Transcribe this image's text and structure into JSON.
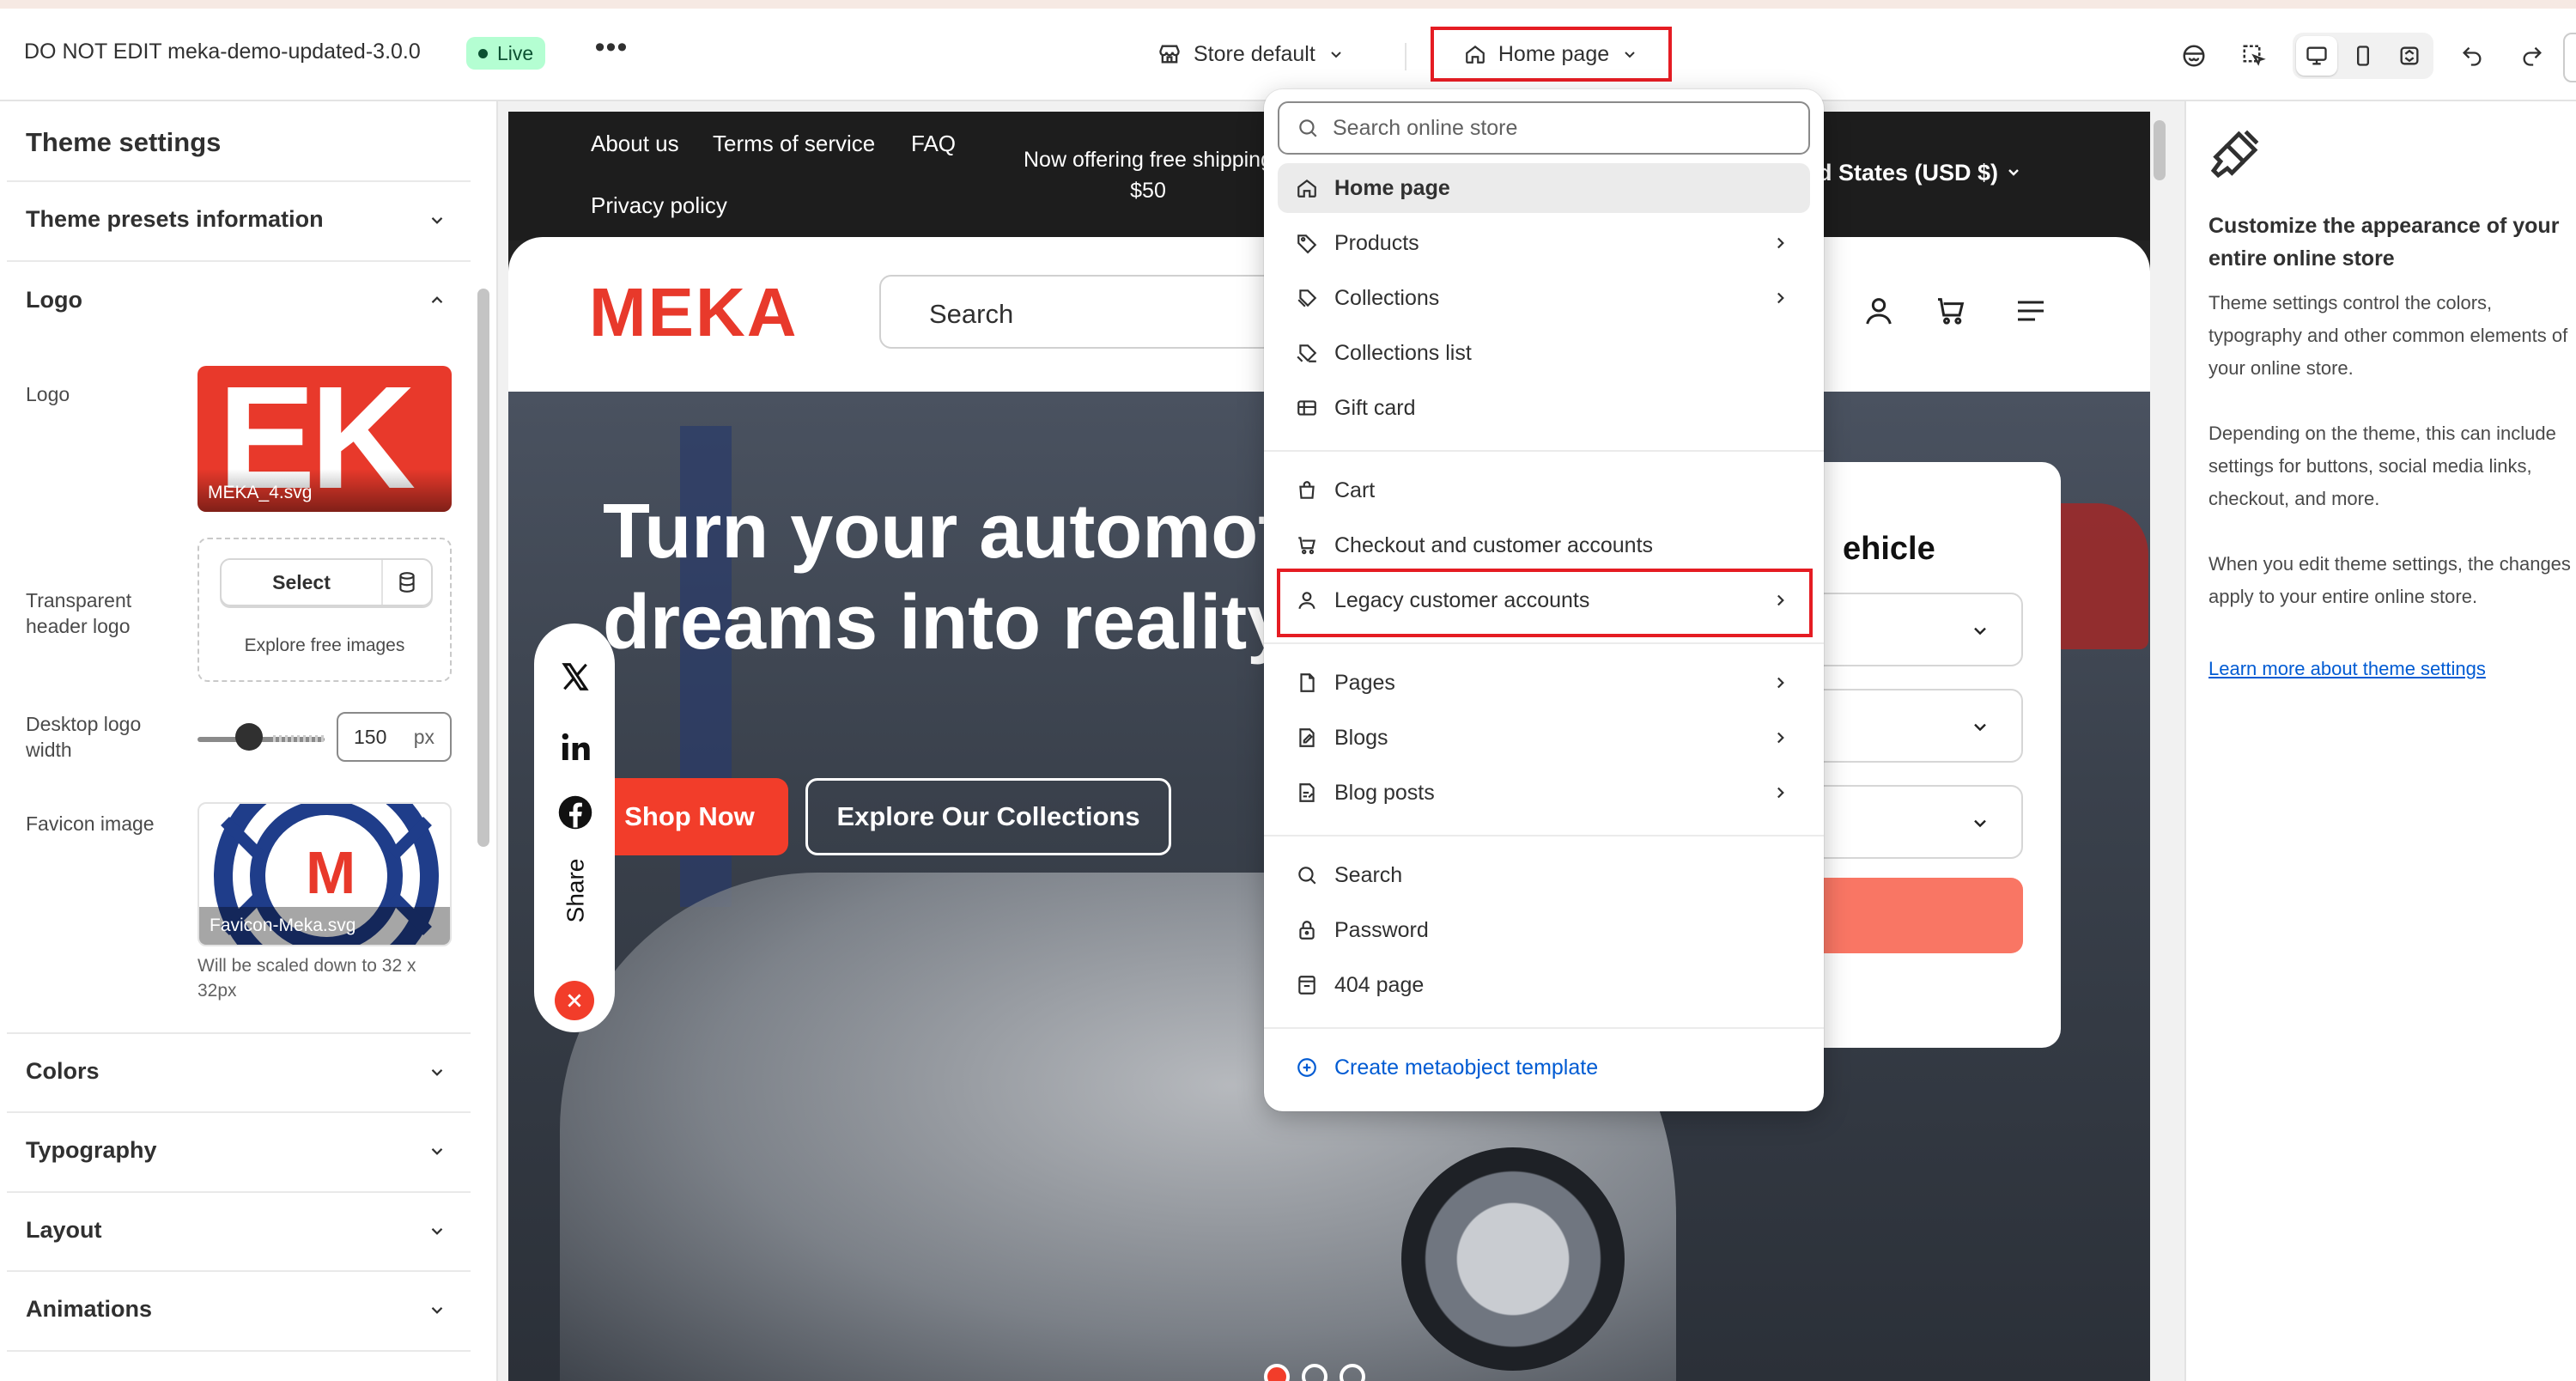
{
  "topbar": {
    "theme_name": "DO NOT EDIT meka-demo-updated-3.0.0",
    "live_badge": "Live",
    "more_label": "•••",
    "store_select": "Store default",
    "template_select": "Home page"
  },
  "left_panel": {
    "title": "Theme settings",
    "sections": {
      "presets": "Theme presets information",
      "logo": "Logo",
      "colors": "Colors",
      "typography": "Typography",
      "layout": "Layout",
      "animations": "Animations"
    },
    "logo_label": "Logo",
    "logo_file": "MEKA_4.svg",
    "logo_art_text": "EK",
    "transparent_logo_label": "Transparent header logo",
    "select_button": "Select",
    "explore_images": "Explore free images",
    "desktop_width_label": "Desktop logo width",
    "desktop_width_value": "150",
    "desktop_width_unit": "px",
    "desktop_width_slider_fraction": 0.2,
    "favicon_label": "Favicon image",
    "favicon_file": "Favicon-Meka.svg",
    "favicon_art_letter": "M",
    "favicon_note": "Will be scaled down to 32 x 32px"
  },
  "preview": {
    "announcement_links": [
      "About us",
      "Terms of service",
      "FAQ",
      "Privacy policy"
    ],
    "announcement_center": "Now offering free shipping $50",
    "currency": "d States (USD $)",
    "brand": "MEKA",
    "search_placeholder": "Search",
    "hero_title": "Turn your automotive\ndreams into reality.",
    "shop_button": "Shop Now",
    "explore_button": "Explore Our Collections",
    "share_label": "Share",
    "find_title": "ehicle",
    "brand_color": "#e8392b"
  },
  "menu": {
    "search_placeholder": "Search online store",
    "items": [
      {
        "label": "Home page",
        "icon": "home-icon"
      },
      {
        "label": "Products",
        "icon": "tag-icon"
      },
      {
        "label": "Collections",
        "icon": "tags-icon"
      },
      {
        "label": "Collections list",
        "icon": "tags-list-icon"
      },
      {
        "label": "Gift card",
        "icon": "gift-card-icon"
      },
      {
        "label": "Cart",
        "icon": "cart-bag-icon"
      },
      {
        "label": "Checkout and customer accounts",
        "icon": "cart-icon"
      },
      {
        "label": "Legacy customer accounts",
        "icon": "person-icon"
      },
      {
        "label": "Pages",
        "icon": "page-icon"
      },
      {
        "label": "Blogs",
        "icon": "blog-icon"
      },
      {
        "label": "Blog posts",
        "icon": "blog-post-icon"
      },
      {
        "label": "Search",
        "icon": "search-icon"
      },
      {
        "label": "Password",
        "icon": "lock-icon"
      },
      {
        "label": "404 page",
        "icon": "404-icon"
      },
      {
        "label": "Create metaobject template",
        "icon": "plus-circle-icon"
      }
    ]
  },
  "right_panel": {
    "title": "Customize the appearance of your entire online store",
    "p1": "Theme settings control the colors, typography and other common elements of your online store.",
    "p2": "Depending on the theme, this can include settings for buttons, social media links, checkout, and more.",
    "p3": "When you edit theme settings, the changes apply to your entire online store.",
    "link": "Learn more about theme settings"
  },
  "colors": {
    "highlight_red": "#e51c23",
    "live_green": "#b4fed2",
    "link_blue": "#005bd3"
  }
}
